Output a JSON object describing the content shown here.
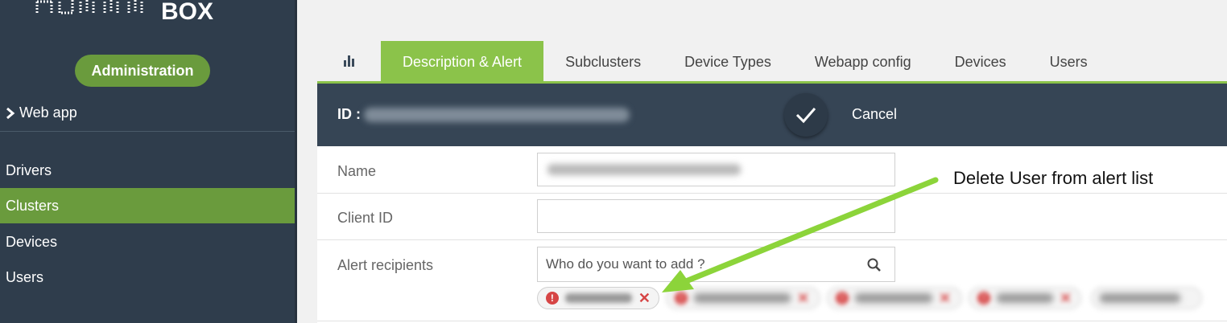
{
  "sidebar": {
    "logo_text": "BOX",
    "admin_label": "Administration",
    "webapp_label": "Web app",
    "items": [
      {
        "label": "Drivers",
        "active": false
      },
      {
        "label": "Clusters",
        "active": true
      },
      {
        "label": "Devices",
        "active": false
      },
      {
        "label": "Users",
        "active": false
      }
    ]
  },
  "tabs": {
    "stats_icon": "bar-chart-icon",
    "items": [
      "Description & Alert",
      "Subclusters",
      "Device Types",
      "Webapp config",
      "Devices",
      "Users"
    ]
  },
  "header": {
    "id_label": "ID :",
    "confirm_icon": "check-icon",
    "cancel_label": "Cancel"
  },
  "form": {
    "name_label": "Name",
    "client_id_label": "Client ID",
    "client_id_value": "",
    "alert_label": "Alert recipients",
    "search_placeholder": "Who do you want to add ?",
    "search_icon": "magnifier-icon"
  },
  "annotation": "Delete User from alert list",
  "colors": {
    "sidebar_bg": "#2f3d4c",
    "accent_green": "#8bc34a",
    "nav_active": "#6a9b3d",
    "header_bg": "#364555",
    "arrow_green": "#8cd43a",
    "delete_red": "#d64545"
  }
}
